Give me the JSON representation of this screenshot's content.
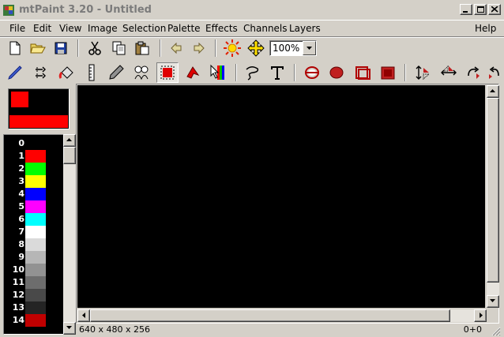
{
  "window": {
    "title": "mtPaint 3.20 - Untitled",
    "buttons": [
      "minimize",
      "maximize",
      "close"
    ]
  },
  "menu": {
    "items": [
      "File",
      "Edit",
      "View",
      "Image",
      "Selection",
      "Palette",
      "Effects",
      "Channels",
      "Layers"
    ],
    "help": "Help"
  },
  "toolbar1": {
    "icons": [
      "new-icon",
      "open-icon",
      "save-icon",
      "cut-icon",
      "copy-icon",
      "paste-icon",
      "undo-icon",
      "redo-icon",
      "brightness-icon",
      "pan-icon"
    ],
    "zoom": "100%"
  },
  "toolbar2": {
    "icons": [
      "paintbrush-icon",
      "shuffle-icon",
      "flood-fill-icon",
      "straight-line-icon",
      "smudge-icon",
      "clone-icon",
      "selection-icon",
      "polygon-select-icon",
      "gradient-icon",
      "lasso-icon",
      "text-icon",
      "ellipse-outline-icon",
      "ellipse-filled-icon",
      "rectangle-outline-icon",
      "rectangle-filled-icon",
      "flip-vertical-icon",
      "flip-horizontal-icon",
      "rotate-clockwise-icon",
      "rotate-anticlockwise-icon"
    ],
    "active": "selection-icon"
  },
  "colors": {
    "colorA": "#ff0000",
    "colorB": "#000000",
    "pattern": "#ff0000"
  },
  "palette": [
    {
      "index": "0",
      "color": "#000000"
    },
    {
      "index": "1",
      "color": "#ff0000"
    },
    {
      "index": "2",
      "color": "#00ff00"
    },
    {
      "index": "3",
      "color": "#ffff00"
    },
    {
      "index": "4",
      "color": "#0000ff"
    },
    {
      "index": "5",
      "color": "#ff00ff"
    },
    {
      "index": "6",
      "color": "#00ffff"
    },
    {
      "index": "7",
      "color": "#ffffff"
    },
    {
      "index": "8",
      "color": "#dadada"
    },
    {
      "index": "9",
      "color": "#b6b6b6"
    },
    {
      "index": "10",
      "color": "#929292"
    },
    {
      "index": "11",
      "color": "#6d6d6d"
    },
    {
      "index": "12",
      "color": "#494949"
    },
    {
      "index": "13",
      "color": "#242424"
    },
    {
      "index": "14",
      "color": "#c00000"
    }
  ],
  "status": {
    "geometry": "640 x 480 x 256",
    "cursor": "0+0"
  }
}
